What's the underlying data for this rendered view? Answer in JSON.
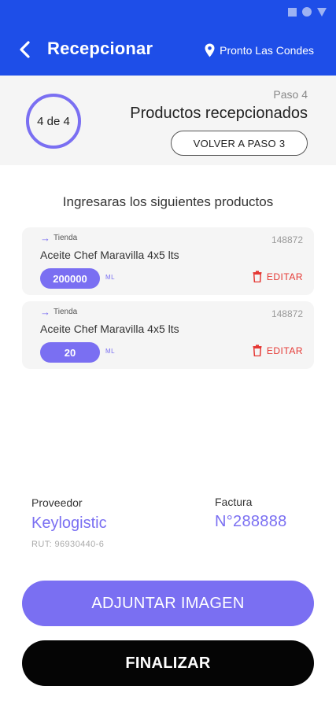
{
  "colors": {
    "primary_blue": "#1e4ee8",
    "accent_purple": "#7a6ff2",
    "danger_red": "#e53935",
    "panel_gray": "#f5f5f5",
    "finish_black": "#050505"
  },
  "status_bar": {
    "icons": [
      "square-icon",
      "circle-icon",
      "triangle-icon"
    ]
  },
  "header": {
    "back_icon": "back-arrow-icon",
    "title": "Recepcionar",
    "location_icon": "location-pin-icon",
    "location": "Pronto Las Condes"
  },
  "step": {
    "progress_text": "4 de 4",
    "current": 4,
    "total": 4,
    "paso_label": "Paso 4",
    "title": "Productos recepcionados",
    "back_button": "VOLVER A PASO 3"
  },
  "products": {
    "heading": "Ingresaras los siguientes productos",
    "items": [
      {
        "origin": "Tienda",
        "sku": "148872",
        "name": "Aceite Chef Maravilla 4x5 lts",
        "quantity": "200000",
        "unit": "ML",
        "edit_label": "EDITAR"
      },
      {
        "origin": "Tienda",
        "sku": "148872",
        "name": "Aceite Chef Maravilla 4x5 lts",
        "quantity": "20",
        "unit": "ML",
        "edit_label": "EDITAR"
      }
    ]
  },
  "supplier": {
    "label": "Proveedor",
    "name": "Keylogistic",
    "rut": "RUT: 96930440-6"
  },
  "invoice": {
    "label": "Factura",
    "number": "N°288888"
  },
  "actions": {
    "attach": "ADJUNTAR IMAGEN",
    "finish": "FINALIZAR"
  }
}
